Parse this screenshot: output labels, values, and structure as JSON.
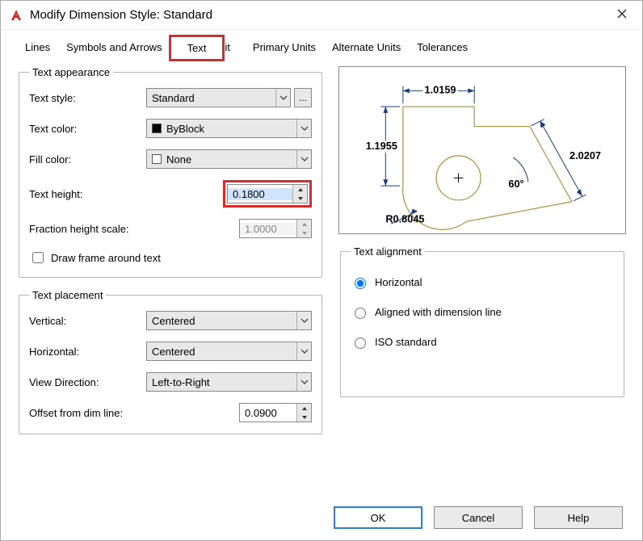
{
  "window": {
    "title": "Modify Dimension Style: Standard"
  },
  "tabs": {
    "lines": "Lines",
    "symbols": "Symbols and Arrows",
    "text": "Text",
    "fit_fragment": "it",
    "primary": "Primary Units",
    "alternate": "Alternate Units",
    "tolerances": "Tolerances"
  },
  "appearance": {
    "legend": "Text appearance",
    "style_label": "Text style:",
    "style_value": "Standard",
    "color_label": "Text color:",
    "color_value": "ByBlock",
    "fill_label": "Fill color:",
    "fill_value": "None",
    "height_label": "Text height:",
    "height_value": "0.1800",
    "fraction_label": "Fraction height scale:",
    "fraction_value": "1.0000",
    "frame_label": "Draw frame around text"
  },
  "placement": {
    "legend": "Text placement",
    "vertical_label": "Vertical:",
    "vertical_value": "Centered",
    "horizontal_label": "Horizontal:",
    "horizontal_value": "Centered",
    "direction_label": "View Direction:",
    "direction_value": "Left-to-Right",
    "offset_label": "Offset from dim line:",
    "offset_value": "0.0900"
  },
  "alignment": {
    "legend": "Text alignment",
    "horizontal": "Horizontal",
    "aligned": "Aligned with dimension line",
    "iso": "ISO standard"
  },
  "preview": {
    "dim_top": "1.0159",
    "dim_left": "1.1955",
    "dim_diag": "2.0207",
    "angle": "60°",
    "radius": "R0.8045"
  },
  "buttons": {
    "ok": "OK",
    "cancel": "Cancel",
    "help": "Help"
  },
  "ellipsis": "..."
}
